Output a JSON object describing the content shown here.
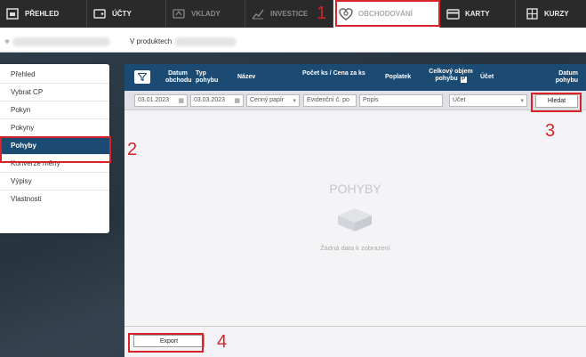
{
  "topnav": {
    "items": [
      {
        "label": "PŘEHLED",
        "icon": "home-icon"
      },
      {
        "label": "ÚČTY",
        "icon": "wallet-icon"
      },
      {
        "label": "VKLADY",
        "icon": "deposit-icon"
      },
      {
        "label": "INVESTICE",
        "icon": "chart-icon"
      },
      {
        "label": "OBCHODOVÁNÍ",
        "icon": "trading-icon"
      },
      {
        "label": "KARTY",
        "icon": "card-icon"
      },
      {
        "label": "KURZY",
        "icon": "grid-icon"
      }
    ]
  },
  "subbar": {
    "label": "V produktech"
  },
  "sidebar": {
    "items": [
      {
        "label": "Přehled"
      },
      {
        "label": "Vybrat CP"
      },
      {
        "label": "Pokyn"
      },
      {
        "label": "Pokyny"
      },
      {
        "label": "Pohyby"
      },
      {
        "label": "Konverze měny"
      },
      {
        "label": "Výpisy"
      },
      {
        "label": "Vlastnosti"
      }
    ]
  },
  "table": {
    "headers": {
      "datum_obchodu": "Datum obchodu",
      "typ_pohybu": "Typ pohybu",
      "nazev": "Název",
      "pocet_cena": "Počet ks / Cena za ks",
      "poplatek": "Poplatek",
      "celkovy_objem": "Celkový objem pohybu",
      "ucet": "Účet",
      "datum_pohybu": "Datum pohybu"
    },
    "filters": {
      "date_from": "03.01.2023",
      "date_to": "03.03.2023",
      "cenny_papir": "Cenný papír",
      "evidencni": "Evidenční č. po",
      "popis": "Popis",
      "ucet": "Účet",
      "search_label": "Hledat"
    },
    "empty": {
      "title": "POHYBY",
      "message": "Žádná data k zobrazení"
    },
    "export_label": "Export"
  },
  "annotations": [
    "1",
    "2",
    "3",
    "4"
  ],
  "colors": {
    "accent": "#1b4a73",
    "annotation": "#d8232a"
  }
}
